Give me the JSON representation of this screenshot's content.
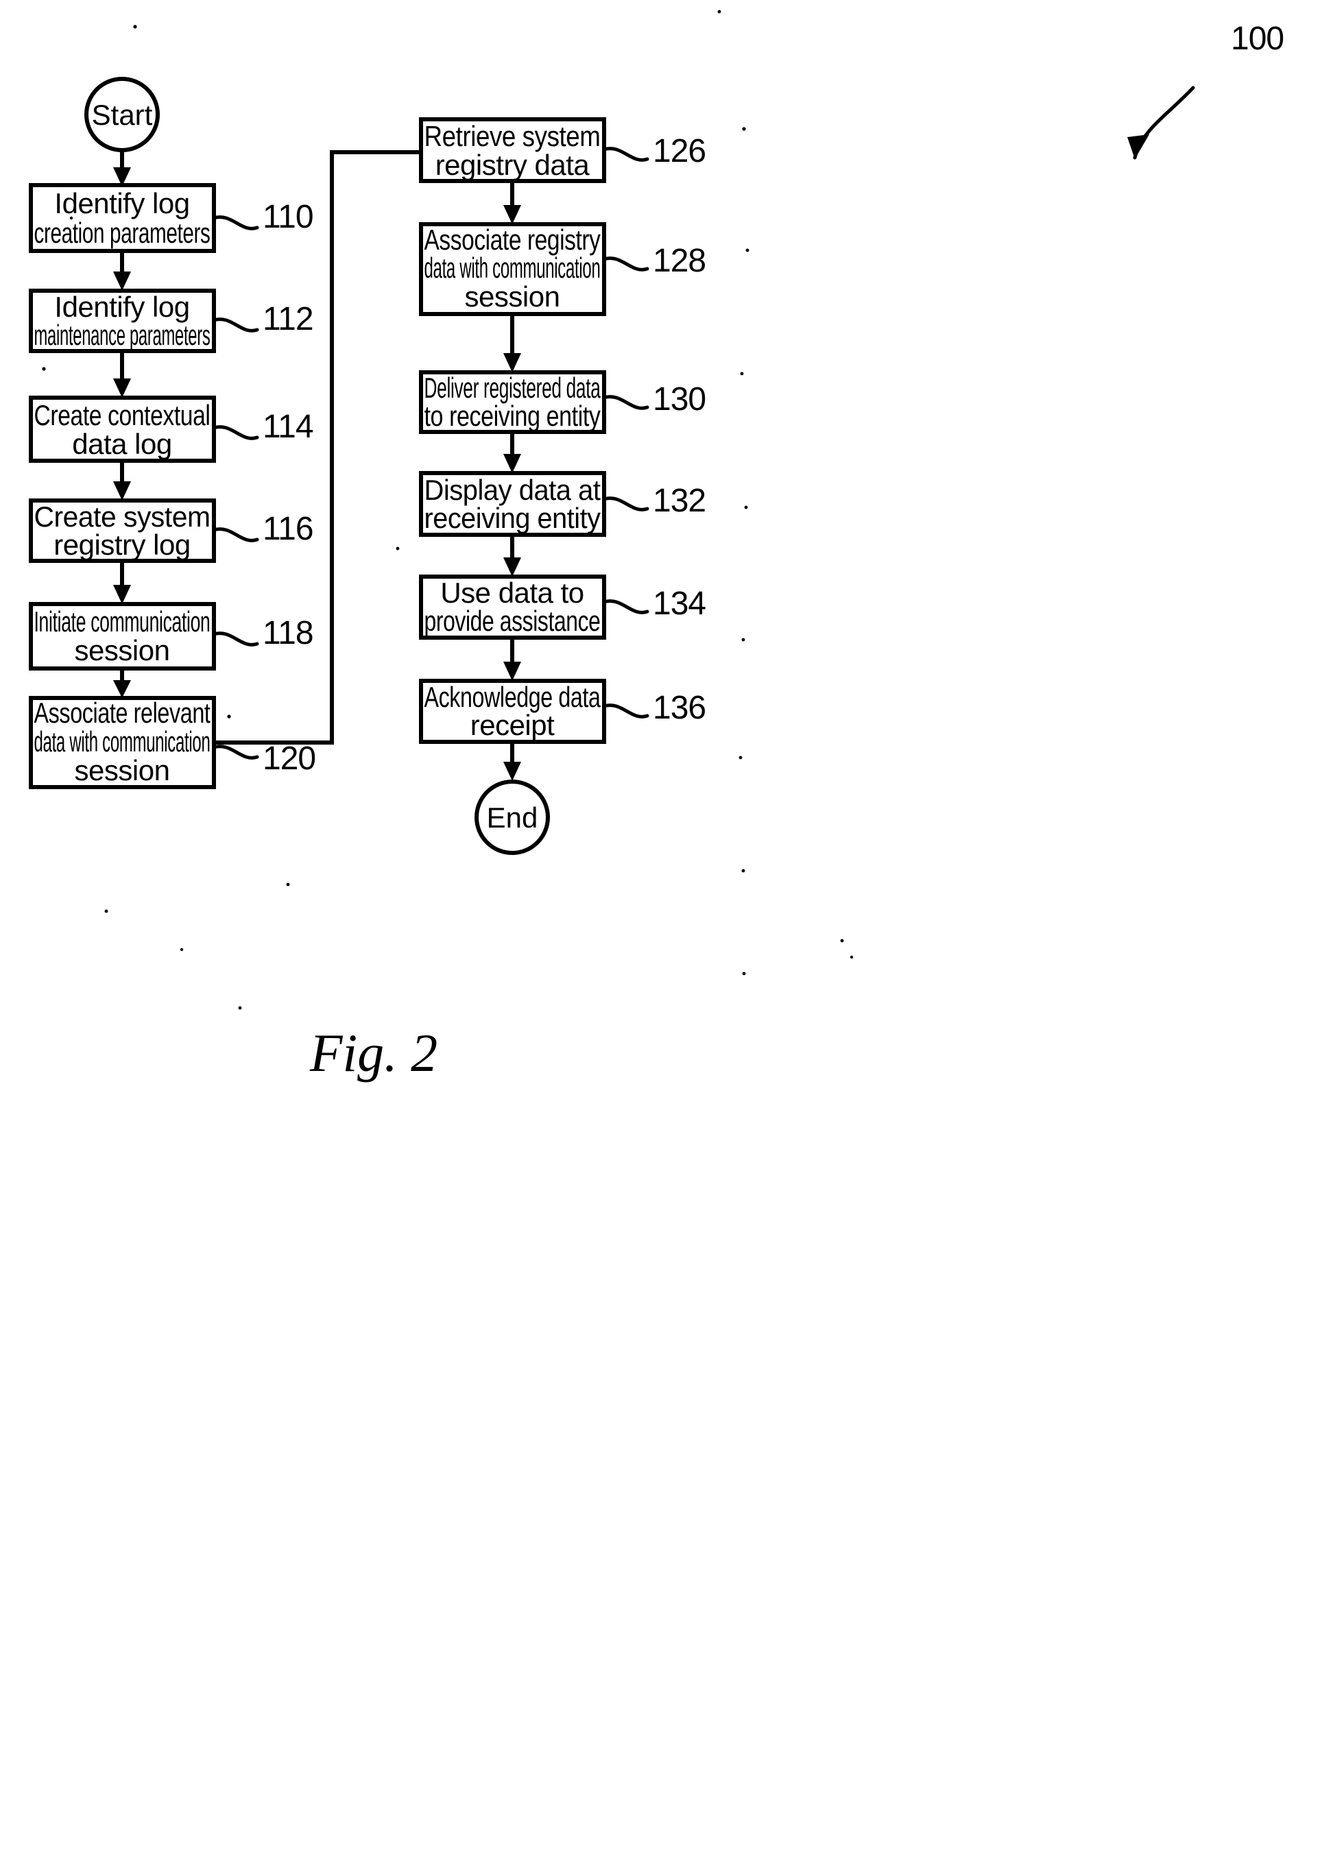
{
  "figure": {
    "caption": "Fig. 2",
    "overall_ref": "100",
    "terminators": {
      "start": "Start",
      "end": "End"
    }
  },
  "left_column": [
    {
      "ref": "110",
      "lines": [
        "Identify log",
        "creation parameters"
      ]
    },
    {
      "ref": "112",
      "lines": [
        "Identify log",
        "maintenance parameters"
      ]
    },
    {
      "ref": "114",
      "lines": [
        "Create contextual",
        "data log"
      ]
    },
    {
      "ref": "116",
      "lines": [
        "Create system",
        "registry log"
      ]
    },
    {
      "ref": "118",
      "lines": [
        "Initiate communication",
        "session"
      ]
    },
    {
      "ref": "120",
      "lines": [
        "Associate relevant",
        "data with communication",
        "session"
      ]
    }
  ],
  "right_column": [
    {
      "ref": "126",
      "lines": [
        "Retrieve system",
        "registry data"
      ]
    },
    {
      "ref": "128",
      "lines": [
        "Associate registry",
        "data with communication",
        "session"
      ]
    },
    {
      "ref": "130",
      "lines": [
        "Deliver registered data",
        "to receiving entity"
      ]
    },
    {
      "ref": "132",
      "lines": [
        "Display data at",
        "receiving entity"
      ]
    },
    {
      "ref": "134",
      "lines": [
        "Use data to",
        "provide assistance"
      ]
    },
    {
      "ref": "136",
      "lines": [
        "Acknowledge data",
        "receipt"
      ]
    }
  ],
  "colors": {
    "ink": "#000000",
    "paper": "#ffffff"
  }
}
